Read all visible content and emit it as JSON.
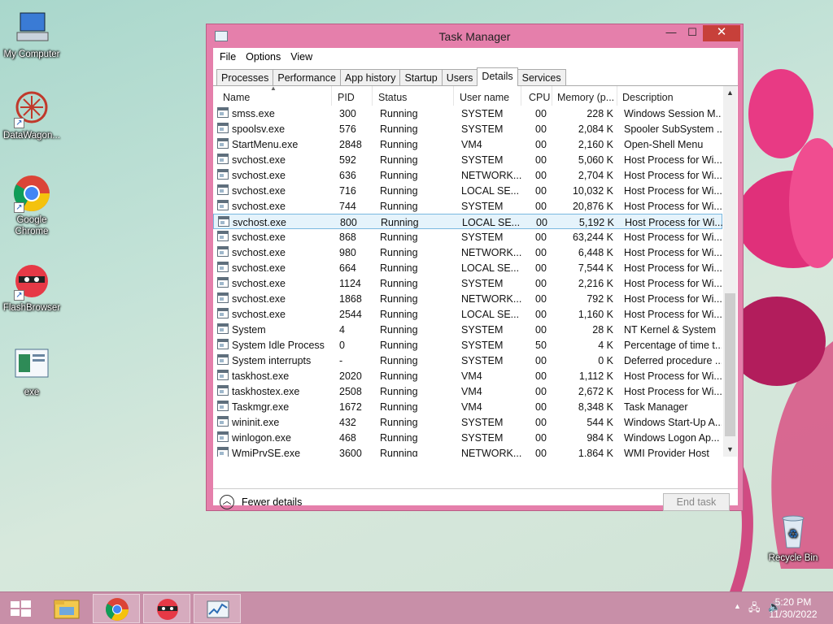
{
  "desktop_icons": [
    {
      "label": "My Computer",
      "icon": "computer-icon"
    },
    {
      "label": "DataWagon...",
      "icon": "datawagon-icon"
    },
    {
      "label": "Google Chrome",
      "icon": "chrome-icon"
    },
    {
      "label": "FlashBrowser",
      "icon": "flashbrowser-icon"
    },
    {
      "label": "exe",
      "icon": "exe-icon"
    },
    {
      "label": "Recycle Bin",
      "icon": "recycle-bin-icon"
    }
  ],
  "window": {
    "title": "Task Manager",
    "minimize": "—",
    "maximize": "☐",
    "close": "✕",
    "menu": [
      "File",
      "Options",
      "View"
    ],
    "tabs": [
      "Processes",
      "Performance",
      "App history",
      "Startup",
      "Users",
      "Details",
      "Services"
    ],
    "active_tab": "Details",
    "columns": [
      "Name",
      "PID",
      "Status",
      "User name",
      "CPU",
      "Memory (p...",
      "Description"
    ],
    "rows": [
      {
        "name": "smss.exe",
        "pid": "300",
        "status": "Running",
        "user": "SYSTEM",
        "cpu": "00",
        "mem": "228 K",
        "desc": "Windows Session M..."
      },
      {
        "name": "spoolsv.exe",
        "pid": "576",
        "status": "Running",
        "user": "SYSTEM",
        "cpu": "00",
        "mem": "2,084 K",
        "desc": "Spooler SubSystem ..."
      },
      {
        "name": "StartMenu.exe",
        "pid": "2848",
        "status": "Running",
        "user": "VM4",
        "cpu": "00",
        "mem": "2,160 K",
        "desc": "Open-Shell Menu"
      },
      {
        "name": "svchost.exe",
        "pid": "592",
        "status": "Running",
        "user": "SYSTEM",
        "cpu": "00",
        "mem": "5,060 K",
        "desc": "Host Process for Wi..."
      },
      {
        "name": "svchost.exe",
        "pid": "636",
        "status": "Running",
        "user": "NETWORK...",
        "cpu": "00",
        "mem": "2,704 K",
        "desc": "Host Process for Wi..."
      },
      {
        "name": "svchost.exe",
        "pid": "716",
        "status": "Running",
        "user": "LOCAL SE...",
        "cpu": "00",
        "mem": "10,032 K",
        "desc": "Host Process for Wi..."
      },
      {
        "name": "svchost.exe",
        "pid": "744",
        "status": "Running",
        "user": "SYSTEM",
        "cpu": "00",
        "mem": "20,876 K",
        "desc": "Host Process for Wi..."
      },
      {
        "name": "svchost.exe",
        "pid": "800",
        "status": "Running",
        "user": "LOCAL SE...",
        "cpu": "00",
        "mem": "5,192 K",
        "desc": "Host Process for Wi...",
        "selected": true
      },
      {
        "name": "svchost.exe",
        "pid": "868",
        "status": "Running",
        "user": "SYSTEM",
        "cpu": "00",
        "mem": "63,244 K",
        "desc": "Host Process for Wi..."
      },
      {
        "name": "svchost.exe",
        "pid": "980",
        "status": "Running",
        "user": "NETWORK...",
        "cpu": "00",
        "mem": "6,448 K",
        "desc": "Host Process for Wi..."
      },
      {
        "name": "svchost.exe",
        "pid": "664",
        "status": "Running",
        "user": "LOCAL SE...",
        "cpu": "00",
        "mem": "7,544 K",
        "desc": "Host Process for Wi..."
      },
      {
        "name": "svchost.exe",
        "pid": "1124",
        "status": "Running",
        "user": "SYSTEM",
        "cpu": "00",
        "mem": "2,216 K",
        "desc": "Host Process for Wi..."
      },
      {
        "name": "svchost.exe",
        "pid": "1868",
        "status": "Running",
        "user": "NETWORK...",
        "cpu": "00",
        "mem": "792 K",
        "desc": "Host Process for Wi..."
      },
      {
        "name": "svchost.exe",
        "pid": "2544",
        "status": "Running",
        "user": "LOCAL SE...",
        "cpu": "00",
        "mem": "1,160 K",
        "desc": "Host Process for Wi..."
      },
      {
        "name": "System",
        "pid": "4",
        "status": "Running",
        "user": "SYSTEM",
        "cpu": "00",
        "mem": "28 K",
        "desc": "NT Kernel & System"
      },
      {
        "name": "System Idle Process",
        "pid": "0",
        "status": "Running",
        "user": "SYSTEM",
        "cpu": "50",
        "mem": "4 K",
        "desc": "Percentage of time t..."
      },
      {
        "name": "System interrupts",
        "pid": "-",
        "status": "Running",
        "user": "SYSTEM",
        "cpu": "00",
        "mem": "0 K",
        "desc": "Deferred procedure ..."
      },
      {
        "name": "taskhost.exe",
        "pid": "2020",
        "status": "Running",
        "user": "VM4",
        "cpu": "00",
        "mem": "1,112 K",
        "desc": "Host Process for Wi..."
      },
      {
        "name": "taskhostex.exe",
        "pid": "2508",
        "status": "Running",
        "user": "VM4",
        "cpu": "00",
        "mem": "2,672 K",
        "desc": "Host Process for Wi..."
      },
      {
        "name": "Taskmgr.exe",
        "pid": "1672",
        "status": "Running",
        "user": "VM4",
        "cpu": "00",
        "mem": "8,348 K",
        "desc": "Task Manager"
      },
      {
        "name": "wininit.exe",
        "pid": "432",
        "status": "Running",
        "user": "SYSTEM",
        "cpu": "00",
        "mem": "544 K",
        "desc": "Windows Start-Up A..."
      },
      {
        "name": "winlogon.exe",
        "pid": "468",
        "status": "Running",
        "user": "SYSTEM",
        "cpu": "00",
        "mem": "984 K",
        "desc": "Windows Logon Ap..."
      },
      {
        "name": "WmiPrvSE.exe",
        "pid": "3600",
        "status": "Running",
        "user": "NETWORK...",
        "cpu": "00",
        "mem": "1,864 K",
        "desc": "WMI Provider Host"
      }
    ],
    "fewer_details": "Fewer details",
    "end_task": "End task"
  },
  "taskbar": {
    "items": [
      "file-explorer-icon",
      "chrome-icon",
      "flashbrowser-icon",
      "task-manager-icon"
    ],
    "time": "5:20 PM",
    "date": "11/30/2022"
  }
}
